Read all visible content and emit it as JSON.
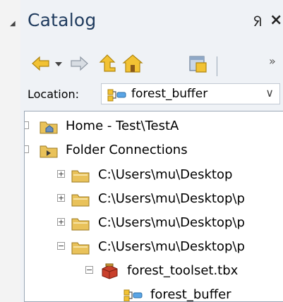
{
  "catalog": {
    "title": "Catalog",
    "pin_glyph": "ᖆ",
    "close_glyph": "×",
    "overflow_glyph": "»"
  },
  "toolbar": {
    "buttons": [
      "back-arrow-icon",
      "dropdown-arrow-icon",
      "forward-arrow-icon",
      "up-one-level-icon",
      "home-icon",
      "toggle-contents-icon"
    ]
  },
  "location": {
    "label": "Location:",
    "value": "forest_buffer",
    "dropdown_glyph": "∨"
  },
  "tree": {
    "items": [
      {
        "label": "Home - Test\\TestA",
        "icon": "home-folder-icon",
        "expander": "partial"
      },
      {
        "label": "Folder Connections",
        "icon": "folder-connection-icon",
        "expander": "partial"
      },
      {
        "label": "C:\\Users\\mu\\Desktop",
        "icon": "folder-icon",
        "expander": "+"
      },
      {
        "label": "C:\\Users\\mu\\Desktop\\p",
        "icon": "folder-icon",
        "expander": "+"
      },
      {
        "label": "C:\\Users\\mu\\Desktop\\p",
        "icon": "folder-icon",
        "expander": "+"
      },
      {
        "label": "C:\\Users\\mu\\Desktop\\p",
        "icon": "folder-icon",
        "expander": "−"
      },
      {
        "label": "forest_toolset.tbx",
        "icon": "toolbox-icon",
        "expander": "−"
      },
      {
        "label": "forest_buffer",
        "icon": "model-tool-icon",
        "expander": ""
      }
    ]
  },
  "colors": {
    "title": "#1f3b5e",
    "panel_bg": "#eff2f6",
    "arrow_yellow": "#e8b41c",
    "arrow_gray": "#a8b0bc",
    "folder_yellow": "#e9c25a"
  }
}
